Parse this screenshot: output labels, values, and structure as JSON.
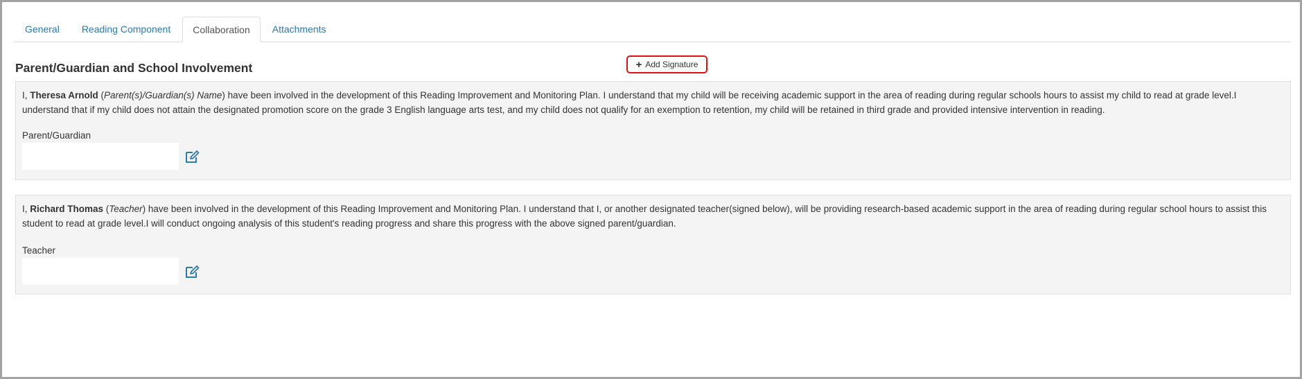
{
  "tabs": [
    {
      "label": "General"
    },
    {
      "label": "Reading Component"
    },
    {
      "label": "Collaboration",
      "active": true
    },
    {
      "label": "Attachments"
    }
  ],
  "section": {
    "title": "Parent/Guardian and School Involvement"
  },
  "add_signature": {
    "label": "Add Signature",
    "icon": "plus-icon",
    "highlight_color": "#e41010"
  },
  "parent_panel": {
    "prefix": "I, ",
    "name": "Theresa Arnold",
    "role_open": " (",
    "role": "Parent(s)/Guardian(s) Name",
    "role_close": ")",
    "body": " have been involved in the development of this Reading Improvement and Monitoring Plan. I understand that my child will be receiving academic support in the area of reading during regular schools hours to assist my child to read at grade level.I understand that if my child does not attain the designated promotion score on the grade 3 English language arts test, and my child does not qualify for an exemption to retention, my child will be retained in third grade and provided intensive intervention in reading.",
    "signature_label": "Parent/Guardian",
    "edit_icon": "edit-icon"
  },
  "teacher_panel": {
    "prefix": "I, ",
    "name": "Richard Thomas",
    "role_open": " (",
    "role": "Teacher",
    "role_close": ")",
    "body": " have been involved in the development of this Reading Improvement and Monitoring Plan. I understand that I, or another designated teacher(signed below), will be providing research-based academic support in the area of reading during regular school hours to assist this student to read at grade level.I will conduct ongoing analysis of this student's reading progress and share this progress with the above signed parent/guardian.",
    "signature_label": "Teacher",
    "edit_icon": "edit-icon"
  },
  "colors": {
    "link": "#2a7ab8",
    "panel_bg": "#f4f4f4"
  }
}
